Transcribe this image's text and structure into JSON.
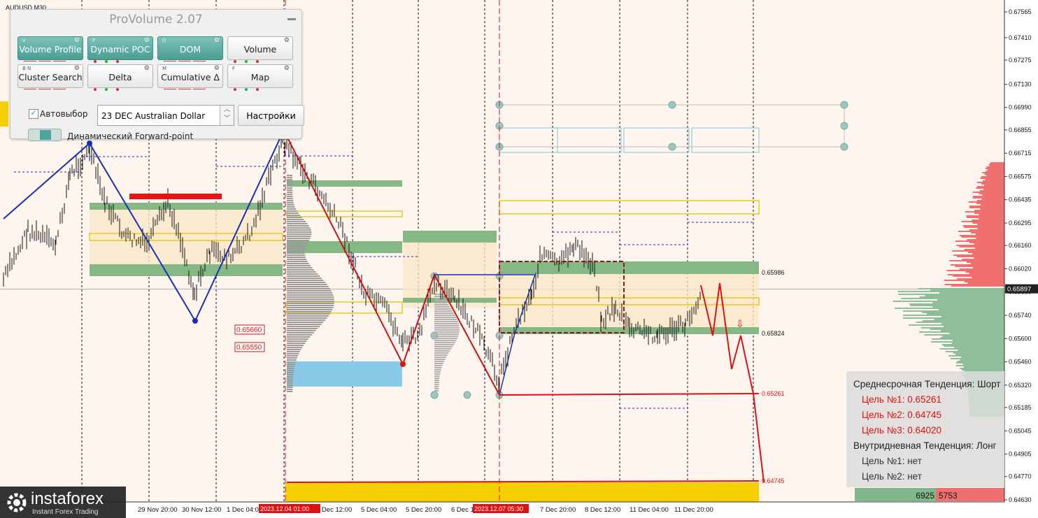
{
  "symbol_title": "AUDUSD,M30",
  "panel": {
    "title": "ProVolume 2.07",
    "buttons": [
      {
        "label": "Volume Profile",
        "hotkey": "V",
        "active": true
      },
      {
        "label": "Dynamic POC",
        "hotkey": "P",
        "active": true
      },
      {
        "label": "DOM",
        "hotkey": "D",
        "active": true
      },
      {
        "label": "Volume",
        "hotkey": "",
        "active": false
      },
      {
        "label": "Cluster Search",
        "hotkey": "B  N",
        "active": false
      },
      {
        "label": "Delta",
        "hotkey": "",
        "active": false
      },
      {
        "label": "Cumulative Δ",
        "hotkey": "M",
        "active": false
      },
      {
        "label": "Map",
        "hotkey": "F",
        "active": false
      }
    ],
    "auto_select_label": "Автовыбор",
    "auto_select_checked": true,
    "contract_select": "23 DEC Australian Dollar",
    "settings_label": "Настройки",
    "forward_point_label": "Динамический Forward-point"
  },
  "price_axis": [
    "0.67565",
    "0.67410",
    "0.67275",
    "0.67130",
    "0.66990",
    "0.66855",
    "0.66715",
    "0.66575",
    "0.66435",
    "0.66295",
    "0.66160",
    "0.66020",
    "0.65880",
    "0.65740",
    "0.65600",
    "0.65460",
    "0.65320",
    "0.65185",
    "0.65045",
    "0.64905",
    "0.64770",
    "0.64630"
  ],
  "current_price": "0.65897",
  "time_axis": [
    "29 Nov 20:00",
    "30 Nov 12:00",
    "1 Dec 04:00",
    "4 Dec 12:00",
    "5 Dec 04:00",
    "5 Dec 20:00",
    "6 Dec 1",
    "7 Dec 20:00",
    "8 Dec 12:00",
    "11 Dec 04:00",
    "11 Dec 20:00"
  ],
  "time_markers": [
    "2023.12.04 01:00",
    "2023.12.07 05:30"
  ],
  "level_labels": [
    "0.65660",
    "0.65550"
  ],
  "chart_levels": [
    "0.65986",
    "0.65824",
    "0.65261",
    "0.64745"
  ],
  "info_box": {
    "mid_trend": "Среднесрочная Тенденция: Шорт",
    "targets_mid": [
      "Цель №1: 0.65261",
      "Цель №2: 0.64745",
      "Цель №3: 0.64020"
    ],
    "intraday_trend": "Внутридневная Тенденция: Лонг",
    "targets_intraday": [
      "Цель №1: нет",
      "Цель №2: нет"
    ]
  },
  "dom_totals": {
    "buy": "6925",
    "sell": "5753"
  },
  "logo": {
    "name": "instaforex",
    "tagline": "Instant Forex Trading"
  },
  "colors": {
    "bid": "#7fb88a",
    "ask": "#f07070",
    "trend_down": "#cc1111",
    "trend_blue": "#1a2fb5",
    "accent": "#4a9e93"
  }
}
